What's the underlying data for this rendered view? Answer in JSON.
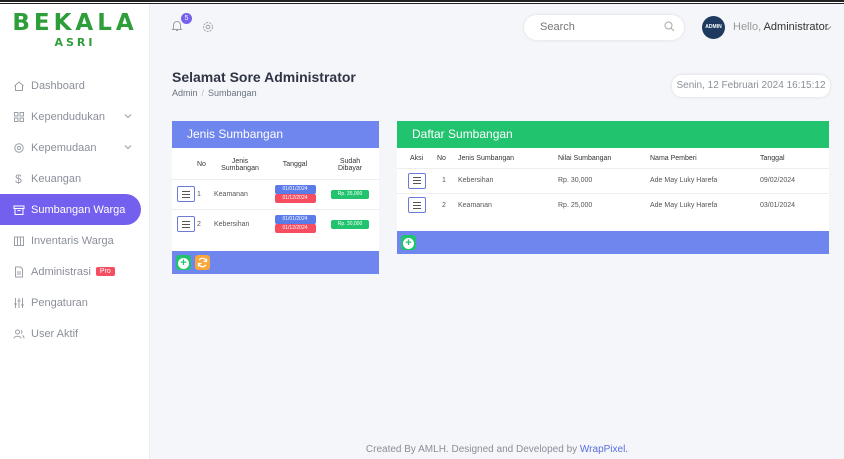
{
  "brand": {
    "name": "BEKALA",
    "subtitle": "ASRI"
  },
  "sidebar": {
    "items": [
      {
        "label": "Dashboard"
      },
      {
        "label": "Kependudukan"
      },
      {
        "label": "Kepemudaan"
      },
      {
        "label": "Keuangan"
      },
      {
        "label": "Sumbangan Warga"
      },
      {
        "label": "Inventaris Warga"
      },
      {
        "label": "Administrasi",
        "badge": "Pro"
      },
      {
        "label": "Pengaturan"
      },
      {
        "label": "User Aktif"
      }
    ]
  },
  "topbar": {
    "notification_count": "5",
    "search_placeholder": "Search",
    "avatar_text": "ADMIN",
    "hello_prefix": "Hello,",
    "user_name": "Administrator"
  },
  "header": {
    "title": "Selamat Sore Administrator",
    "breadcrumb": [
      "Admin",
      "Sumbangan"
    ],
    "datetime": "Senin, 12 Februari 2024 16:15:12"
  },
  "jenis_card": {
    "title": "Jenis Sumbangan",
    "columns": [
      "No",
      "Jenis Sumbangan",
      "Tanggal",
      "Sudah Dibayar"
    ],
    "rows": [
      {
        "no": "1",
        "jenis": "Keamanan",
        "tgl_mulai": "01/01/2024",
        "tgl_akhir": "01/12/2024",
        "dibayar": "Rp. 35,000"
      },
      {
        "no": "2",
        "jenis": "Kebersihan",
        "tgl_mulai": "01/01/2024",
        "tgl_akhir": "01/12/2024",
        "dibayar": "Rp. 30,000"
      }
    ]
  },
  "daftar_card": {
    "title": "Daftar Sumbangan",
    "columns": [
      "Aksi",
      "No",
      "Jenis Sumbangan",
      "Nilai Sumbangan",
      "Nama Pemberi",
      "Tanggal"
    ],
    "rows": [
      {
        "no": "1",
        "jenis": "Kebersihan",
        "nilai": "Rp. 30,000",
        "pemberi": "Ade May Luky Harefa",
        "tanggal": "09/02/2024"
      },
      {
        "no": "2",
        "jenis": "Keamanan",
        "nilai": "Rp. 25,000",
        "pemberi": "Ade May Luky Harefa",
        "tanggal": "03/01/2024"
      }
    ]
  },
  "footer": {
    "text": "Created By AMLH. Designed and Developed by",
    "link": "WrapPixel."
  },
  "colors": {
    "brand_green": "#2e9e3a",
    "accent_purple": "#7460ee",
    "card_blue": "#6f86ee",
    "card_green": "#21c36e",
    "danger_red": "#f64e60"
  }
}
